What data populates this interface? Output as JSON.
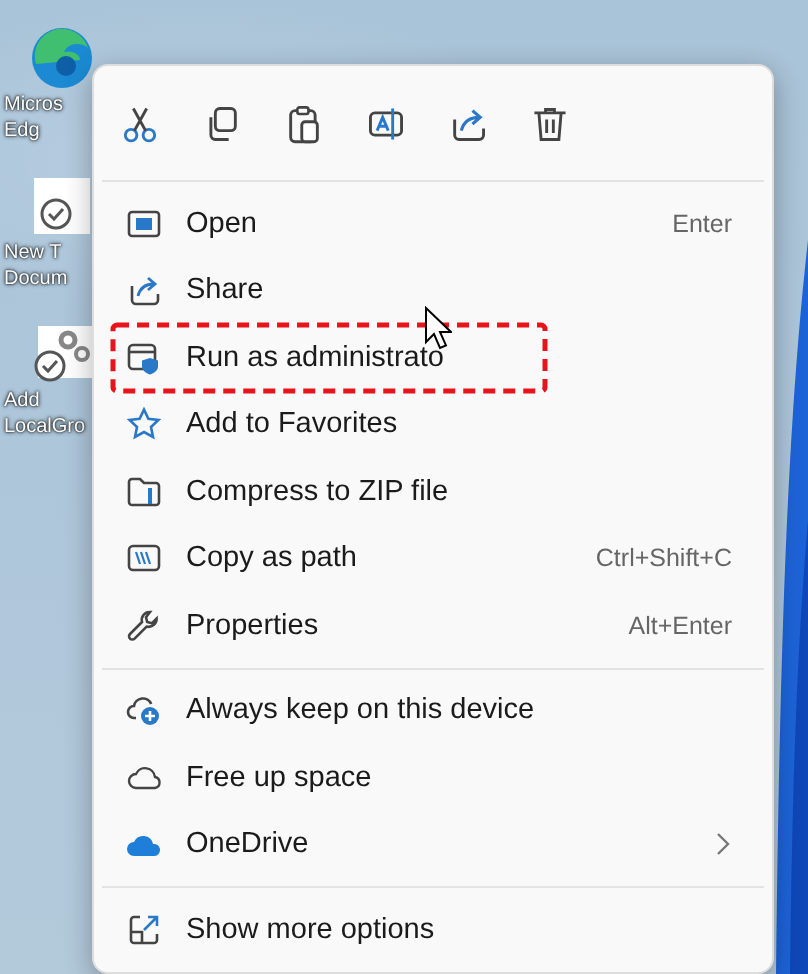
{
  "desktop_icons": [
    {
      "lines": [
        "Micros",
        "Edg"
      ]
    },
    {
      "lines": [
        "New T",
        "Docum"
      ]
    },
    {
      "lines": [
        "Add",
        "LocalGro"
      ]
    }
  ],
  "context_menu": {
    "sections": [
      [
        {
          "label": "Open",
          "shortcut": "Enter",
          "highlighted": false,
          "submenu": false
        },
        {
          "label": "Share",
          "highlighted": false,
          "submenu": false
        },
        {
          "label": "Run as administrato",
          "highlighted": true,
          "submenu": false
        },
        {
          "label": "Add to Favorites",
          "highlighted": false,
          "submenu": false
        },
        {
          "label": "Compress to ZIP file",
          "highlighted": false,
          "submenu": false
        },
        {
          "label": "Copy as path",
          "shortcut": "Ctrl+Shift+C",
          "highlighted": false,
          "submenu": false
        },
        {
          "label": "Properties",
          "shortcut": "Alt+Enter",
          "highlighted": false,
          "submenu": false
        }
      ],
      [
        {
          "label": "Always keep on this device",
          "highlighted": false,
          "submenu": false
        },
        {
          "label": "Free up space",
          "highlighted": false,
          "submenu": false
        },
        {
          "label": "OneDrive",
          "highlighted": false,
          "submenu": true
        }
      ],
      [
        {
          "label": "Show more options",
          "highlighted": false,
          "submenu": false
        }
      ]
    ]
  }
}
